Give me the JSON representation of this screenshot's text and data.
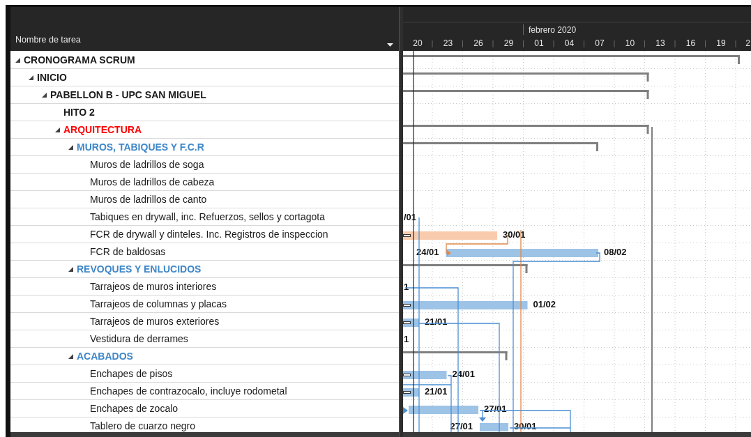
{
  "header": {
    "column": "Nombre de tarea"
  },
  "timescale": {
    "month": "febrero 2020",
    "days": [
      "20",
      "23",
      "26",
      "29",
      "01",
      "04",
      "07",
      "10",
      "13",
      "16",
      "19",
      "2"
    ]
  },
  "tasks": [
    {
      "name": "CRONOGRAMA SCRUM",
      "expanded": true,
      "color": "#1a1a1a",
      "bar": {
        "kind": "summary"
      },
      "children": [
        {
          "name": "INICIO",
          "expanded": true,
          "color": "#1a1a1a",
          "bar": {
            "kind": "summary"
          },
          "children": [
            {
              "name": "PABELLON B - UPC SAN MIGUEL",
              "expanded": true,
              "color": "#1a1a1a",
              "bar": {
                "kind": "summary"
              },
              "children": [
                {
                  "name": "HITO 2",
                  "kind": "milestone",
                  "color": "#1a1a1a"
                },
                {
                  "name": "ARQUITECTURA",
                  "expanded": true,
                  "color": "#ff0000",
                  "bar": {
                    "kind": "summary"
                  },
                  "children": [
                    {
                      "name": "MUROS, TABIQUES Y F.C.R",
                      "expanded": true,
                      "color": "#3f87c8",
                      "bar": {
                        "kind": "summary"
                      },
                      "children": [
                        {
                          "name": "Muros de ladrillos de soga",
                          "kind": "task",
                          "color": "#1a1a1a"
                        },
                        {
                          "name": "Muros de ladrillos de cabeza",
                          "kind": "task",
                          "color": "#1a1a1a"
                        },
                        {
                          "name": "Muros de ladrillos de canto",
                          "kind": "task",
                          "color": "#1a1a1a"
                        },
                        {
                          "name": "Tabiques en drywall, inc. Refuerzos, sellos y cortagota",
                          "kind": "task",
                          "color": "#1a1a1a",
                          "bar": {
                            "kind": "normal",
                            "end_label": "/01"
                          }
                        },
                        {
                          "name": "FCR de drywall y dinteles. Inc. Registros de inspeccion",
                          "kind": "task",
                          "color": "#1a1a1a",
                          "bar": {
                            "kind": "critical",
                            "end_label": "30/01"
                          }
                        },
                        {
                          "name": "FCR de baldosas",
                          "kind": "task",
                          "color": "#1a1a1a",
                          "bar": {
                            "kind": "normal",
                            "start_label": "24/01",
                            "end_label": "08/02"
                          }
                        }
                      ]
                    },
                    {
                      "name": "REVOQUES Y ENLUCIDOS",
                      "expanded": true,
                      "color": "#3f87c8",
                      "bar": {
                        "kind": "summary"
                      },
                      "children": [
                        {
                          "name": "Tarrajeos de muros interiores",
                          "kind": "task",
                          "color": "#1a1a1a",
                          "bar": {
                            "kind": "normal",
                            "end_label": "1"
                          }
                        },
                        {
                          "name": "Tarrajeos de columnas y placas",
                          "kind": "task",
                          "color": "#1a1a1a",
                          "bar": {
                            "kind": "normal",
                            "end_label": "01/02"
                          }
                        },
                        {
                          "name": "Tarrajeos de muros exteriores",
                          "kind": "task",
                          "color": "#1a1a1a",
                          "bar": {
                            "kind": "normal",
                            "end_label": "21/01"
                          }
                        },
                        {
                          "name": "Vestidura de derrames",
                          "kind": "task",
                          "color": "#1a1a1a",
                          "bar": {
                            "kind": "normal",
                            "end_label": "1"
                          }
                        }
                      ]
                    },
                    {
                      "name": "ACABADOS",
                      "expanded": true,
                      "color": "#3f87c8",
                      "bar": {
                        "kind": "summary"
                      },
                      "children": [
                        {
                          "name": "Enchapes de pisos",
                          "kind": "task",
                          "color": "#1a1a1a",
                          "bar": {
                            "kind": "normal",
                            "end_label": "24/01"
                          }
                        },
                        {
                          "name": "Enchapes de contrazocalo, incluye rodometal",
                          "kind": "task",
                          "color": "#1a1a1a",
                          "bar": {
                            "kind": "normal",
                            "end_label": "21/01"
                          }
                        },
                        {
                          "name": "Enchapes de zocalo",
                          "kind": "task",
                          "color": "#1a1a1a",
                          "bar": {
                            "kind": "normal",
                            "end_label": "27/01"
                          }
                        },
                        {
                          "name": "Tablero de cuarzo negro",
                          "kind": "task",
                          "color": "#1a1a1a",
                          "bar": {
                            "kind": "normal",
                            "start_label": "27/01",
                            "end_label": "30/01"
                          }
                        }
                      ]
                    }
                  ]
                }
              ]
            }
          ]
        }
      ]
    }
  ]
}
